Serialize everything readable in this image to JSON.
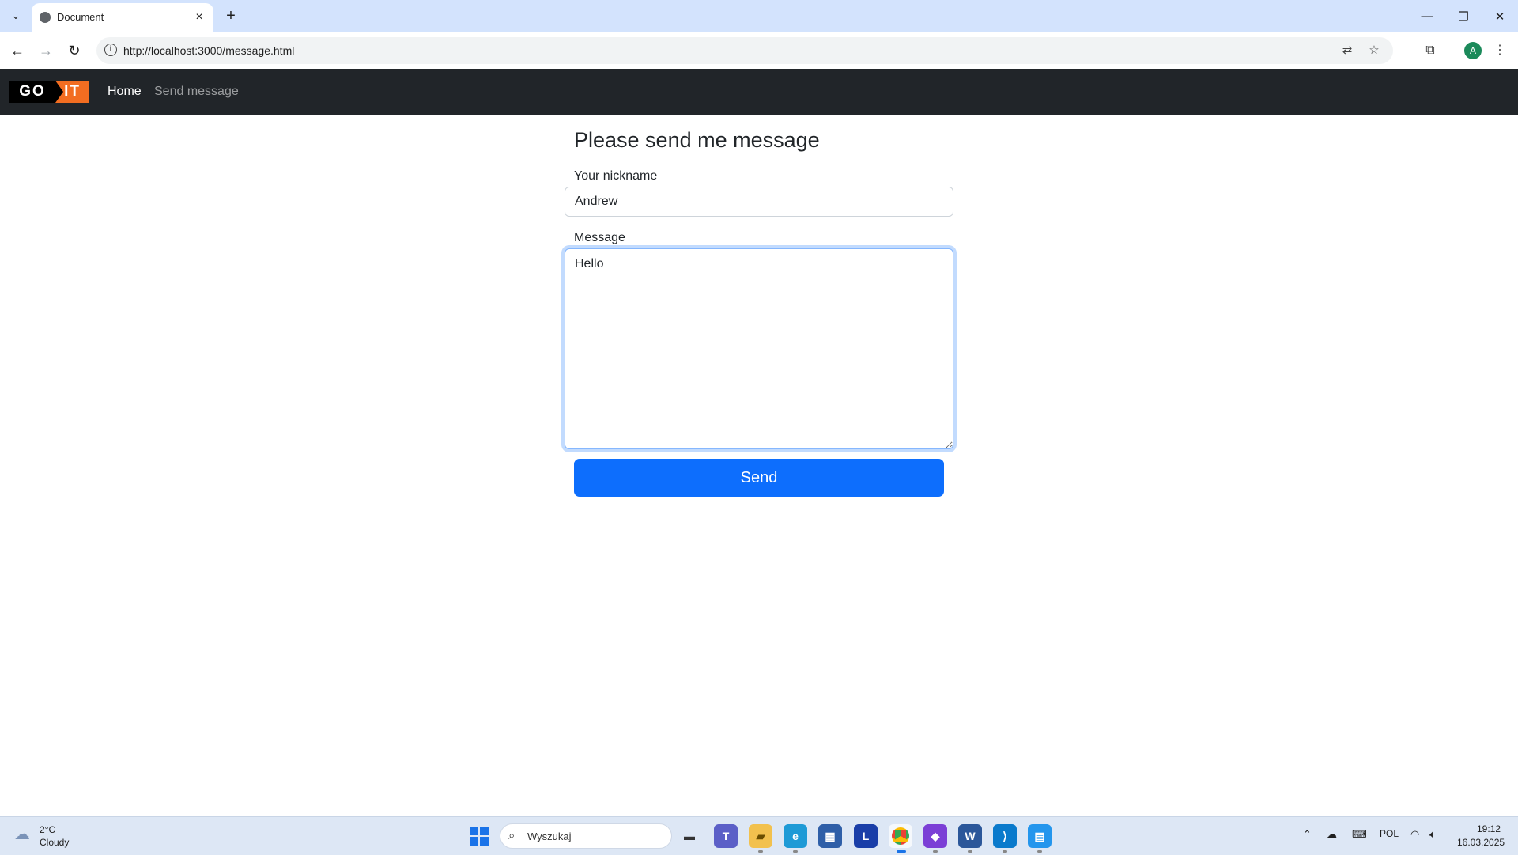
{
  "browser": {
    "tab_title": "Document",
    "url": "http://localhost:3000/message.html",
    "profile_initial": "A"
  },
  "navbar": {
    "logo_left": "GO",
    "logo_right": "IT",
    "links": [
      {
        "label": "Home"
      },
      {
        "label": "Send message"
      }
    ]
  },
  "form": {
    "title": "Please send me message",
    "nickname_label": "Your nickname",
    "nickname_value": "Andrew",
    "message_label": "Message",
    "message_value": "Hello",
    "send_label": "Send"
  },
  "taskbar": {
    "weather_temp": "2°C",
    "weather_desc": "Cloudy",
    "search_placeholder": "Wyszukaj",
    "language": "POL",
    "time": "19:12",
    "date": "16.03.2025"
  },
  "colors": {
    "navbar_bg": "#212529",
    "primary": "#0d6efd",
    "logo_orange": "#f26d21",
    "tabstrip_bg": "#d3e3fd"
  }
}
